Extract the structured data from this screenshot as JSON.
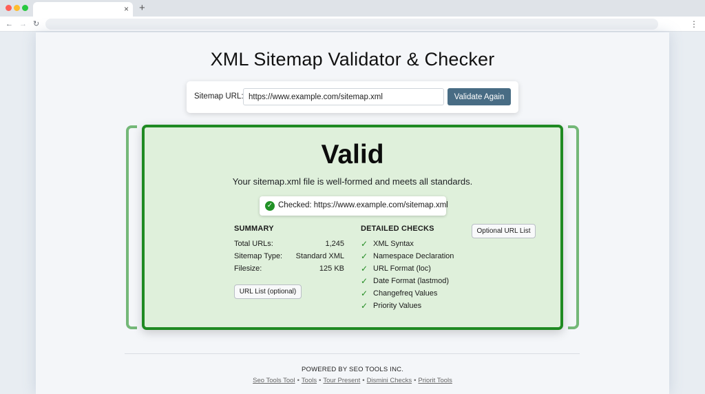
{
  "browser": {
    "tab_close": "×",
    "new_tab": "+",
    "nav_back": "←",
    "nav_forward": "→",
    "nav_reload": "↻",
    "menu": "⋮"
  },
  "page": {
    "title": "XML Sitemap Validator & Checker",
    "form": {
      "label": "Sitemap URL:",
      "url_value": "https://www.example.com/sitemap.xml",
      "button_label": "Validate Again"
    },
    "result": {
      "status": "Valid",
      "message": "Your sitemap.xml file is well-formed and meets all standards.",
      "checked_icon": "✓",
      "checked_text": "Checked: https://www.example.com/sitemap.xml",
      "summary": {
        "heading": "SUMMARY",
        "rows": [
          {
            "label": "Total URLs:",
            "value": "1,245"
          },
          {
            "label": "Sitemap Type:",
            "value": "Standard XML"
          },
          {
            "label": "Filesize:",
            "value": "125 KB"
          }
        ],
        "url_list_button": "URL List (optional)"
      },
      "detailed_checks": {
        "heading": "DETAILED CHECKS",
        "tick": "✓",
        "items": [
          "XML Syntax",
          "Namespace Declaration",
          "URL Format (loc)",
          "Date Format (lastmod)",
          "Changefreq Values",
          "Priority Values"
        ]
      },
      "optional_button": "Optional URL List"
    },
    "footer": {
      "powered_prefix": "POWERED BY ",
      "powered_brand": "SEO TOOLS",
      "powered_suffix": " INC.",
      "separator": "•",
      "links": [
        "Seo Tools Tool",
        "Tools",
        "Tour Present",
        "Dismini Checks",
        "Priorit Tools"
      ]
    }
  },
  "colors": {
    "accent_button": "#486c84",
    "success_border": "#1f8a22",
    "success_bg": "#dff0db",
    "bracket": "#74b878"
  }
}
